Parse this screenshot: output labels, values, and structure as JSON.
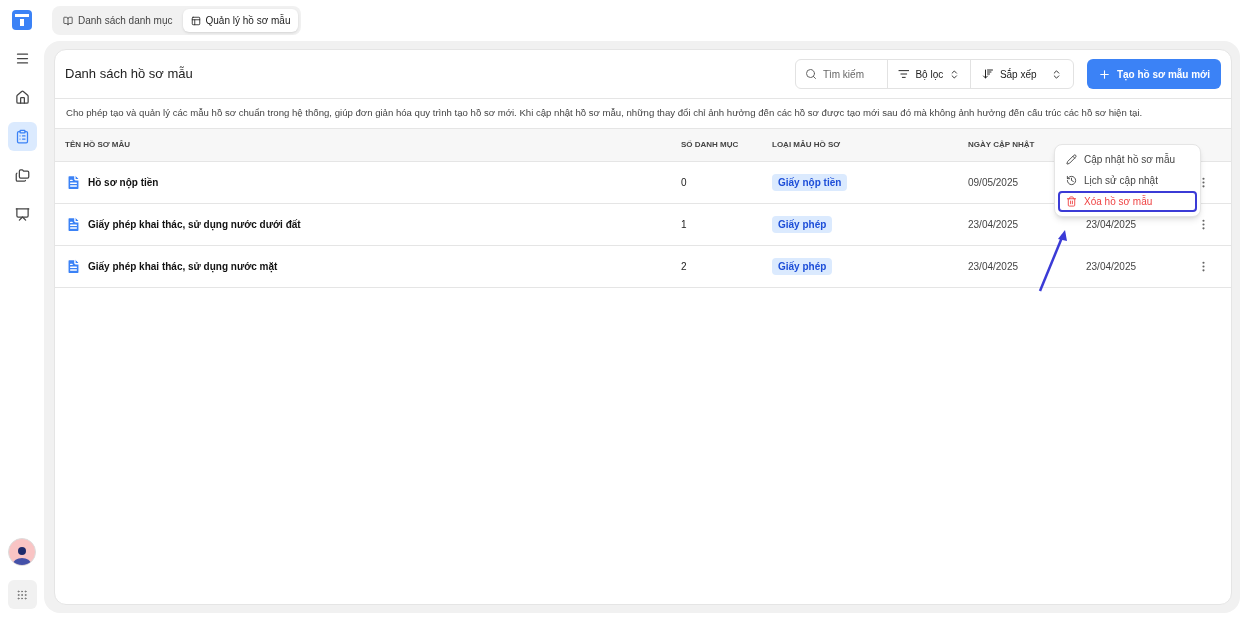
{
  "sidebar": {
    "items": [
      {
        "selected": false
      },
      {
        "selected": false
      },
      {
        "selected": true
      },
      {
        "selected": false
      },
      {
        "selected": false
      }
    ]
  },
  "tabs": [
    {
      "label": "Danh sách danh mục",
      "selected": false
    },
    {
      "label": "Quản lý hồ sơ mẫu",
      "selected": true
    }
  ],
  "page": {
    "title": "Danh sách hồ sơ mẫu",
    "search": {
      "placeholder": "Tìm kiếm"
    },
    "filter": "Bộ lọc",
    "sort": "Sắp xếp",
    "create_button": "Tạo hồ sơ mẫu mới",
    "description": "Cho phép tạo và quản lý các mẫu hồ sơ chuẩn trong hệ thống, giúp đơn giản hóa quy trình tạo hồ sơ mới. Khi cập nhật hồ sơ mẫu, những thay đổi chỉ ảnh hưởng đến các hồ sơ được tạo mới sau đó mà không ảnh hưởng đến cấu trúc các hồ sơ hiện tại."
  },
  "table": {
    "columns": [
      "TÊN HỒ SƠ MẪU",
      "SỐ DANH MỤC",
      "LOẠI MẪU HỒ SƠ",
      "NGÀY CẬP NHẬT"
    ],
    "rows": [
      {
        "name": "Hồ sơ nộp tiền",
        "count": "0",
        "type": "Giấy nộp tiền",
        "updated": "09/05/2025"
      },
      {
        "name": "Giấy phép khai thác, sử dụng nước dưới đất",
        "count": "1",
        "type": "Giấy phép",
        "updated": "23/04/2025",
        "column_5": "23/04/2025"
      },
      {
        "name": "Giấy phép khai thác, sử dụng nước mặt",
        "count": "2",
        "type": "Giấy phép",
        "updated": "23/04/2025",
        "column_5": "23/04/2025"
      }
    ]
  },
  "context_menu": {
    "items": [
      {
        "label": "Cập nhật hồ sơ mẫu",
        "kind": "edit",
        "highlighted": false
      },
      {
        "label": "Lịch sử cập nhật",
        "kind": "history",
        "highlighted": false
      },
      {
        "label": "Xóa hồ sơ mẫu",
        "kind": "delete",
        "highlighted": true
      }
    ]
  }
}
